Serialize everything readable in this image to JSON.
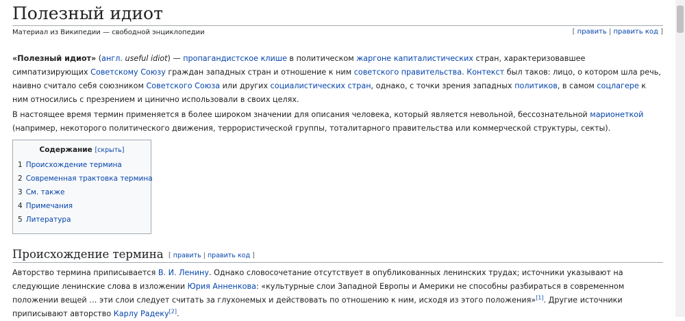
{
  "article": {
    "title": "Полезный идиот",
    "tagline": "Материал из Википедии — свободной энциклопедии",
    "edit": "править",
    "edit_code": "править код",
    "bracket_open": "[ ",
    "bracket_close": " ]",
    "sep": " | "
  },
  "intro": {
    "term": "«Полезный идиот»",
    "paren_open": " (",
    "lang": "англ.",
    "orig": " useful idiot",
    "paren_close": ") — ",
    "l1": "пропагандистское клише",
    "t1": " в политическом ",
    "l2": "жаргоне",
    "t2": " ",
    "l3": "капиталистических",
    "t3": " стран, характеризовавшее симпатизирующих ",
    "l4": "Советскому Союзу",
    "t4": " граждан западных стран и отношение к ним ",
    "l5": "советского правительства",
    "t5": ". ",
    "l6": "Контекст",
    "t6": " был таков: лицо, о котором шла речь, наивно считало себя союзником ",
    "l7": "Советского Союза",
    "t7": " или других ",
    "l8": "социалистических стран",
    "t8": ", однако, с точки зрения западных ",
    "l9": "политиков",
    "t9": ", в самом ",
    "l10": "соцлагере",
    "t10": " к ним относились с презрением и цинично использовали в своих целях."
  },
  "para2": {
    "t1": "В настоящее время термин применяется в более широком значении для описания человека, который является невольной, бессознательной ",
    "l1": "марионеткой",
    "t2": " (например, некоторого политического движения, террористической группы, тоталитарного правительства или коммерческой структуры, секты)."
  },
  "toc": {
    "title": "Содержание",
    "toggle": "[скрыть]",
    "items": [
      {
        "num": "1",
        "label": "Происхождение термина"
      },
      {
        "num": "2",
        "label": "Современная трактовка термина"
      },
      {
        "num": "3",
        "label": "См. также"
      },
      {
        "num": "4",
        "label": "Примечания"
      },
      {
        "num": "5",
        "label": "Литература"
      }
    ]
  },
  "section1": {
    "heading": "Происхождение термина",
    "t1": "Авторство термина приписывается ",
    "l1": "В. И. Ленину",
    "t2": ". Однако словосочетание отсутствует в опубликованных ленинских трудах; источники указывают на следующие ленинские слова в изложении ",
    "l2": "Юрия Анненкова",
    "t3": ": «культурные слои Западной Европы и Америки не способны разбираться в современном положении вещей … эти слои следует считать за глухонемых и действовать по отношению к ним, исходя из этого положения»",
    "ref1": "[1]",
    "t4": ". Другие источники приписывают авторство ",
    "l3": "Карлу Радеку",
    "ref2": "[2]",
    "t5": "."
  }
}
